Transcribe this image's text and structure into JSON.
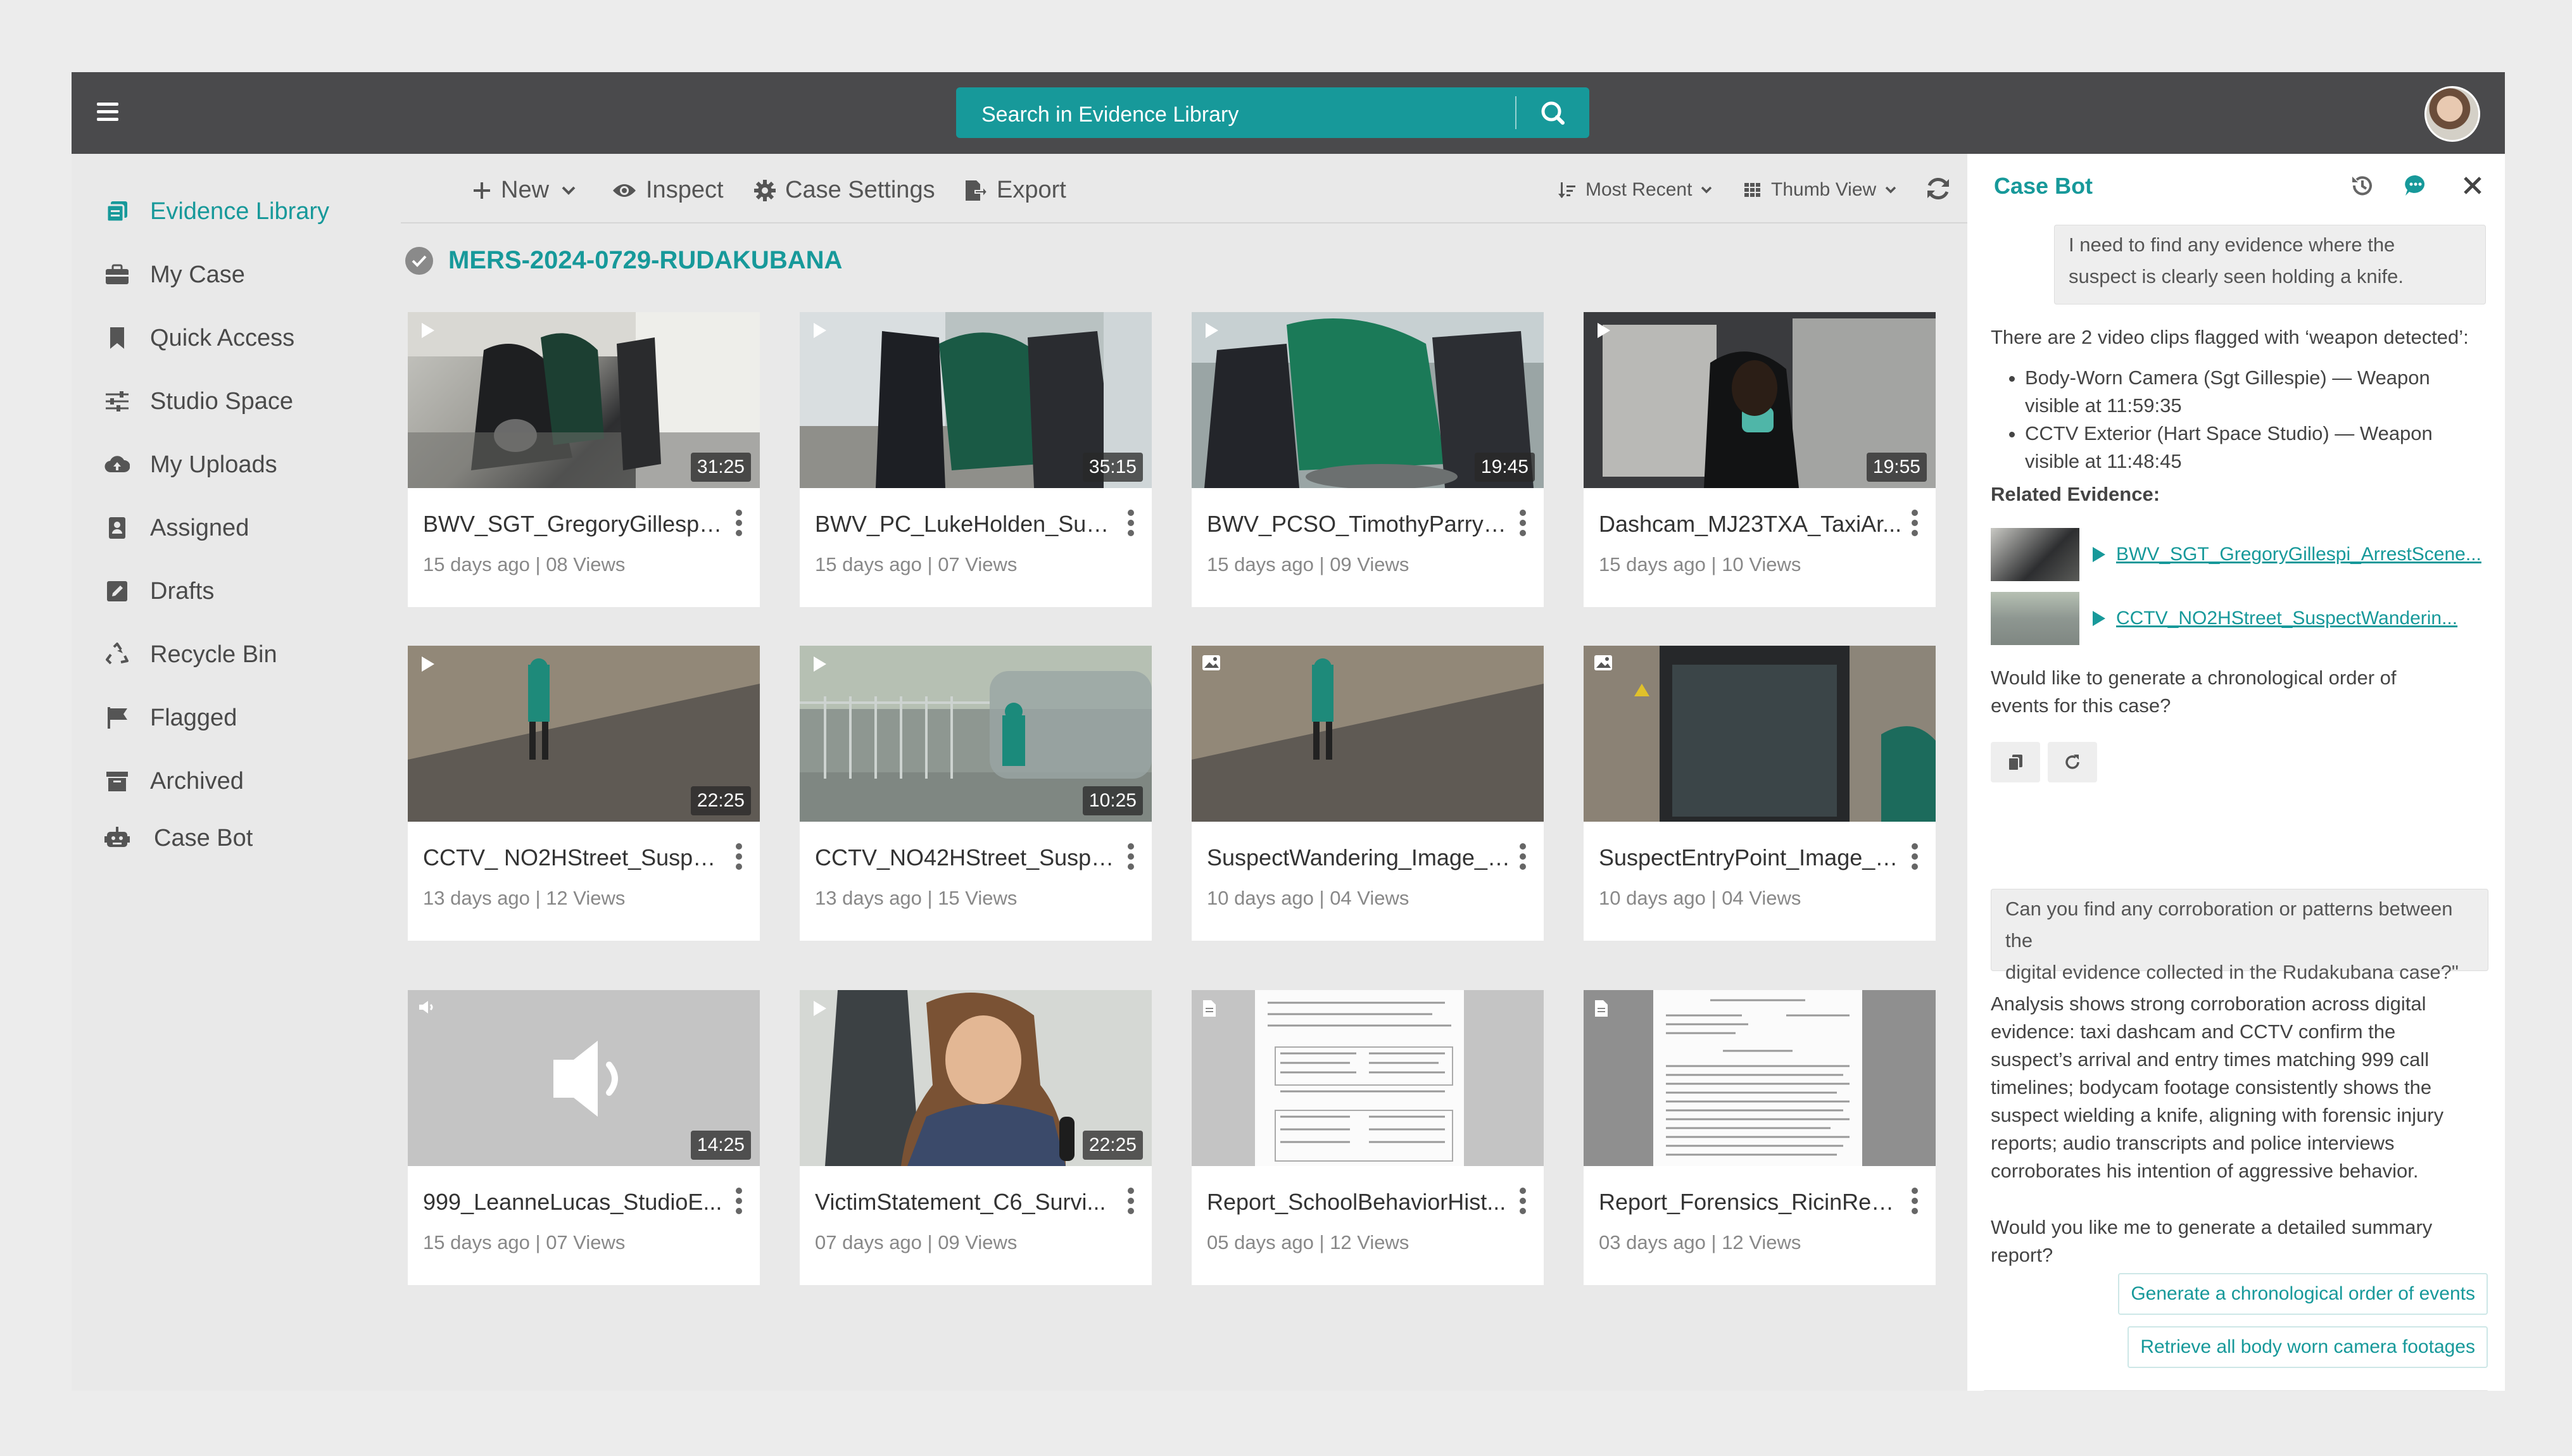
{
  "search": {
    "placeholder": "Search in Evidence Library"
  },
  "sidebar": {
    "items": [
      {
        "label": "Evidence Library",
        "icon": "library-icon"
      },
      {
        "label": "My Case",
        "icon": "briefcase-icon"
      },
      {
        "label": "Quick Access",
        "icon": "bookmark-icon"
      },
      {
        "label": "Studio Space",
        "icon": "sliders-icon"
      },
      {
        "label": "My Uploads",
        "icon": "cloud-upload-icon"
      },
      {
        "label": "Assigned",
        "icon": "assigned-icon"
      },
      {
        "label": "Drafts",
        "icon": "edit-icon"
      },
      {
        "label": "Recycle Bin",
        "icon": "recycle-icon"
      },
      {
        "label": "Flagged",
        "icon": "flag-icon"
      },
      {
        "label": "Archived",
        "icon": "archive-icon"
      },
      {
        "label": "Case Bot",
        "icon": "robot-icon"
      }
    ]
  },
  "toolbar": {
    "new_label": "New",
    "inspect_label": "Inspect",
    "case_settings_label": "Case Settings",
    "export_label": "Export",
    "sort_label": "Most Recent",
    "view_label": "Thumb View"
  },
  "case": {
    "title": "MERS-2024-0729-RUDAKUBANA"
  },
  "cards": [
    {
      "title": "BWV_SGT_GregoryGillespi_...",
      "meta": "15 days ago | 08 Views",
      "duration": "31:25",
      "type": "video"
    },
    {
      "title": "BWV_PC_LukeHolden_Supp...",
      "meta": "15 days ago | 07 Views",
      "duration": "35:15",
      "type": "video"
    },
    {
      "title": "BWV_PCSO_TimothyParry_...",
      "meta": "15 days ago | 09 Views",
      "duration": "19:45",
      "type": "video"
    },
    {
      "title": "Dashcam_MJ23TXA_TaxiAr...",
      "meta": "15 days ago | 10 Views",
      "duration": "19:55",
      "type": "video"
    },
    {
      "title": "CCTV_ NO2HStreet_Suspec...",
      "meta": "13 days ago | 12 Views",
      "duration": "22:25",
      "type": "video"
    },
    {
      "title": "CCTV_NO42HStreet_Suspect",
      "meta": "13 days ago | 15 Views",
      "duration": "10:25",
      "type": "video"
    },
    {
      "title": "SuspectWandering_Image_11",
      "meta": "10 days ago | 04 Views",
      "duration": "",
      "type": "image"
    },
    {
      "title": "SuspectEntryPoint_Image_1...",
      "meta": "10 days ago | 04 Views",
      "duration": "",
      "type": "image"
    },
    {
      "title": "999_LeanneLucas_StudioE...",
      "meta": "15 days ago | 07 Views",
      "duration": "14:25",
      "type": "audio"
    },
    {
      "title": "VictimStatement_C6_Survi...",
      "meta": "07 days ago | 09 Views",
      "duration": "22:25",
      "type": "video"
    },
    {
      "title": "Report_SchoolBehaviorHist...",
      "meta": "05 days ago | 12 Views",
      "duration": "",
      "type": "document"
    },
    {
      "title": "Report_Forensics_RicinResi...",
      "meta": "03 days ago | 12 Views",
      "duration": "",
      "type": "document"
    }
  ],
  "chat": {
    "title": "Case Bot",
    "q1_line1": "I need to find any evidence where the",
    "q1_line2": "suspect is clearly seen holding a knife.",
    "a1_intro": "There are 2 video clips flagged with ‘weapon detected’:",
    "a1_b1_l1": "Body-Worn Camera (Sgt Gillespie) — Weapon",
    "a1_b1_l2": "visible at 11:59:35",
    "a1_b2_l1": "CCTV Exterior (Hart Space Studio) — Weapon",
    "a1_b2_l2": "visible at 11:48:45",
    "related_label": "Related Evidence:",
    "related_1": "BWV_SGT_GregoryGillespi_ArrestScene...",
    "related_2": "CCTV_NO2HStreet_SuspectWanderin...",
    "follow1_l1": "Would like to generate a chronological order of",
    "follow1_l2": "events for this case?",
    "q2_line1": "Can you find any corroboration or patterns between the",
    "q2_line2": "digital evidence collected in the Rudakubana case?\"",
    "a2_l1": "Analysis shows strong corroboration across digital",
    "a2_l2": "evidence: taxi dashcam and CCTV confirm the",
    "a2_l3": "suspect’s arrival and entry times matching 999 call",
    "a2_l4": "timelines; bodycam footage consistently shows the",
    "a2_l5": "suspect wielding a knife, aligning with forensic injury",
    "a2_l6": "reports; audio transcripts and police interviews",
    "a2_l7": "corroborates his intention of aggressive behavior.",
    "follow2_l1": "Would you like me to generate a detailed summary",
    "follow2_l2": "report?",
    "suggest_1": "Generate a chronological order of events",
    "suggest_2": "Retrieve all body worn camera footages"
  },
  "colors": {
    "accent": "#17999a",
    "topbar": "#4a4a4c"
  }
}
